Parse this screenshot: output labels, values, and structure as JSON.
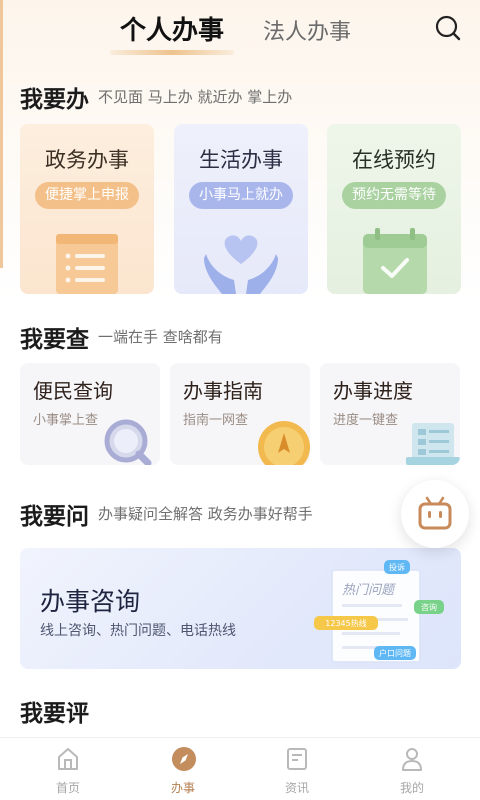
{
  "header": {
    "tabs": [
      "个人办事",
      "法人办事"
    ],
    "active_tab": 0
  },
  "sections": {
    "do": {
      "title": "我要办",
      "subtitle": "不见面 马上办 就近办 掌上办"
    },
    "check": {
      "title": "我要查",
      "subtitle": "一端在手 查啥都有"
    },
    "ask": {
      "title": "我要问",
      "subtitle": "办事疑问全解答 政务办事好帮手"
    },
    "rate": {
      "title": "我要评"
    }
  },
  "do_cards": [
    {
      "title": "政务办事",
      "tag": "便捷掌上申报",
      "icon": "document-icon",
      "color": "#f4c08a"
    },
    {
      "title": "生活办事",
      "tag": "小事马上就办",
      "icon": "heart-hands-icon",
      "color": "#a9b6ec"
    },
    {
      "title": "在线预约",
      "tag": "预约无需等待",
      "icon": "calendar-check-icon",
      "color": "#a9d2a0"
    }
  ],
  "check_cards": [
    {
      "title": "便民查询",
      "desc": "小事掌上查",
      "icon": "magnifier-icon"
    },
    {
      "title": "办事指南",
      "desc": "指南一网查",
      "icon": "compass-coin-icon"
    },
    {
      "title": "办事进度",
      "desc": "进度一键查",
      "icon": "progress-sheet-icon"
    }
  ],
  "consult": {
    "title": "办事咨询",
    "desc": "线上咨询、热门问题、电话热线",
    "illustration": {
      "heading": "热门问题",
      "tags": [
        "投诉",
        "咨询",
        "12345热线",
        "户口问题"
      ]
    }
  },
  "tabbar": {
    "items": [
      {
        "label": "首页",
        "icon": "home-icon"
      },
      {
        "label": "办事",
        "icon": "compass-icon"
      },
      {
        "label": "资讯",
        "icon": "news-icon"
      },
      {
        "label": "我的",
        "icon": "profile-icon"
      }
    ],
    "active": 1
  },
  "colors": {
    "accent": "#b58152",
    "tab_underline": "#eec38d"
  }
}
